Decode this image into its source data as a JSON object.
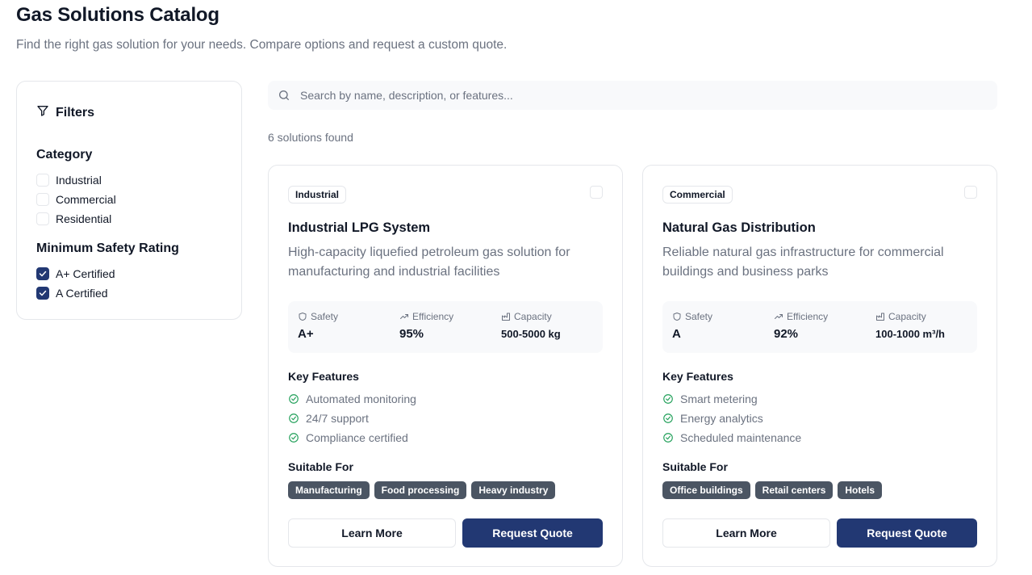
{
  "header": {
    "title": "Gas Solutions Catalog",
    "subtitle": "Find the right gas solution for your needs. Compare options and request a custom quote."
  },
  "filters": {
    "title": "Filters",
    "category_title": "Category",
    "categories": [
      {
        "label": "Industrial",
        "checked": false
      },
      {
        "label": "Commercial",
        "checked": false
      },
      {
        "label": "Residential",
        "checked": false
      }
    ],
    "safety_title": "Minimum Safety Rating",
    "safety": [
      {
        "label": "A+ Certified",
        "checked": true
      },
      {
        "label": "A Certified",
        "checked": true
      }
    ]
  },
  "search": {
    "placeholder": "Search by name, description, or features...",
    "value": ""
  },
  "results": {
    "count_text": "6 solutions found"
  },
  "labels": {
    "safety": "Safety",
    "efficiency": "Efficiency",
    "capacity": "Capacity",
    "key_features": "Key Features",
    "suitable_for": "Suitable For",
    "learn_more": "Learn More",
    "request_quote": "Request Quote"
  },
  "cards": [
    {
      "category": "Industrial",
      "title": "Industrial LPG System",
      "description": "High-capacity liquefied petroleum gas solution for manufacturing and industrial facilities",
      "safety": "A+",
      "efficiency": "95%",
      "capacity": "500-5000 kg",
      "features": [
        "Automated monitoring",
        "24/7 support",
        "Compliance certified"
      ],
      "suitable_for": [
        "Manufacturing",
        "Food processing",
        "Heavy industry"
      ],
      "selected": false
    },
    {
      "category": "Commercial",
      "title": "Natural Gas Distribution",
      "description": "Reliable natural gas infrastructure for commercial buildings and business parks",
      "safety": "A",
      "efficiency": "92%",
      "capacity": "100-1000 m³/h",
      "features": [
        "Smart metering",
        "Energy analytics",
        "Scheduled maintenance"
      ],
      "suitable_for": [
        "Office buildings",
        "Retail centers",
        "Hotels"
      ],
      "selected": false
    }
  ],
  "colors": {
    "primary": "#223873",
    "tag_bg": "#4b5563",
    "muted_text": "#6b7280",
    "border": "#e5e7eb",
    "check_green": "#22a05a"
  }
}
